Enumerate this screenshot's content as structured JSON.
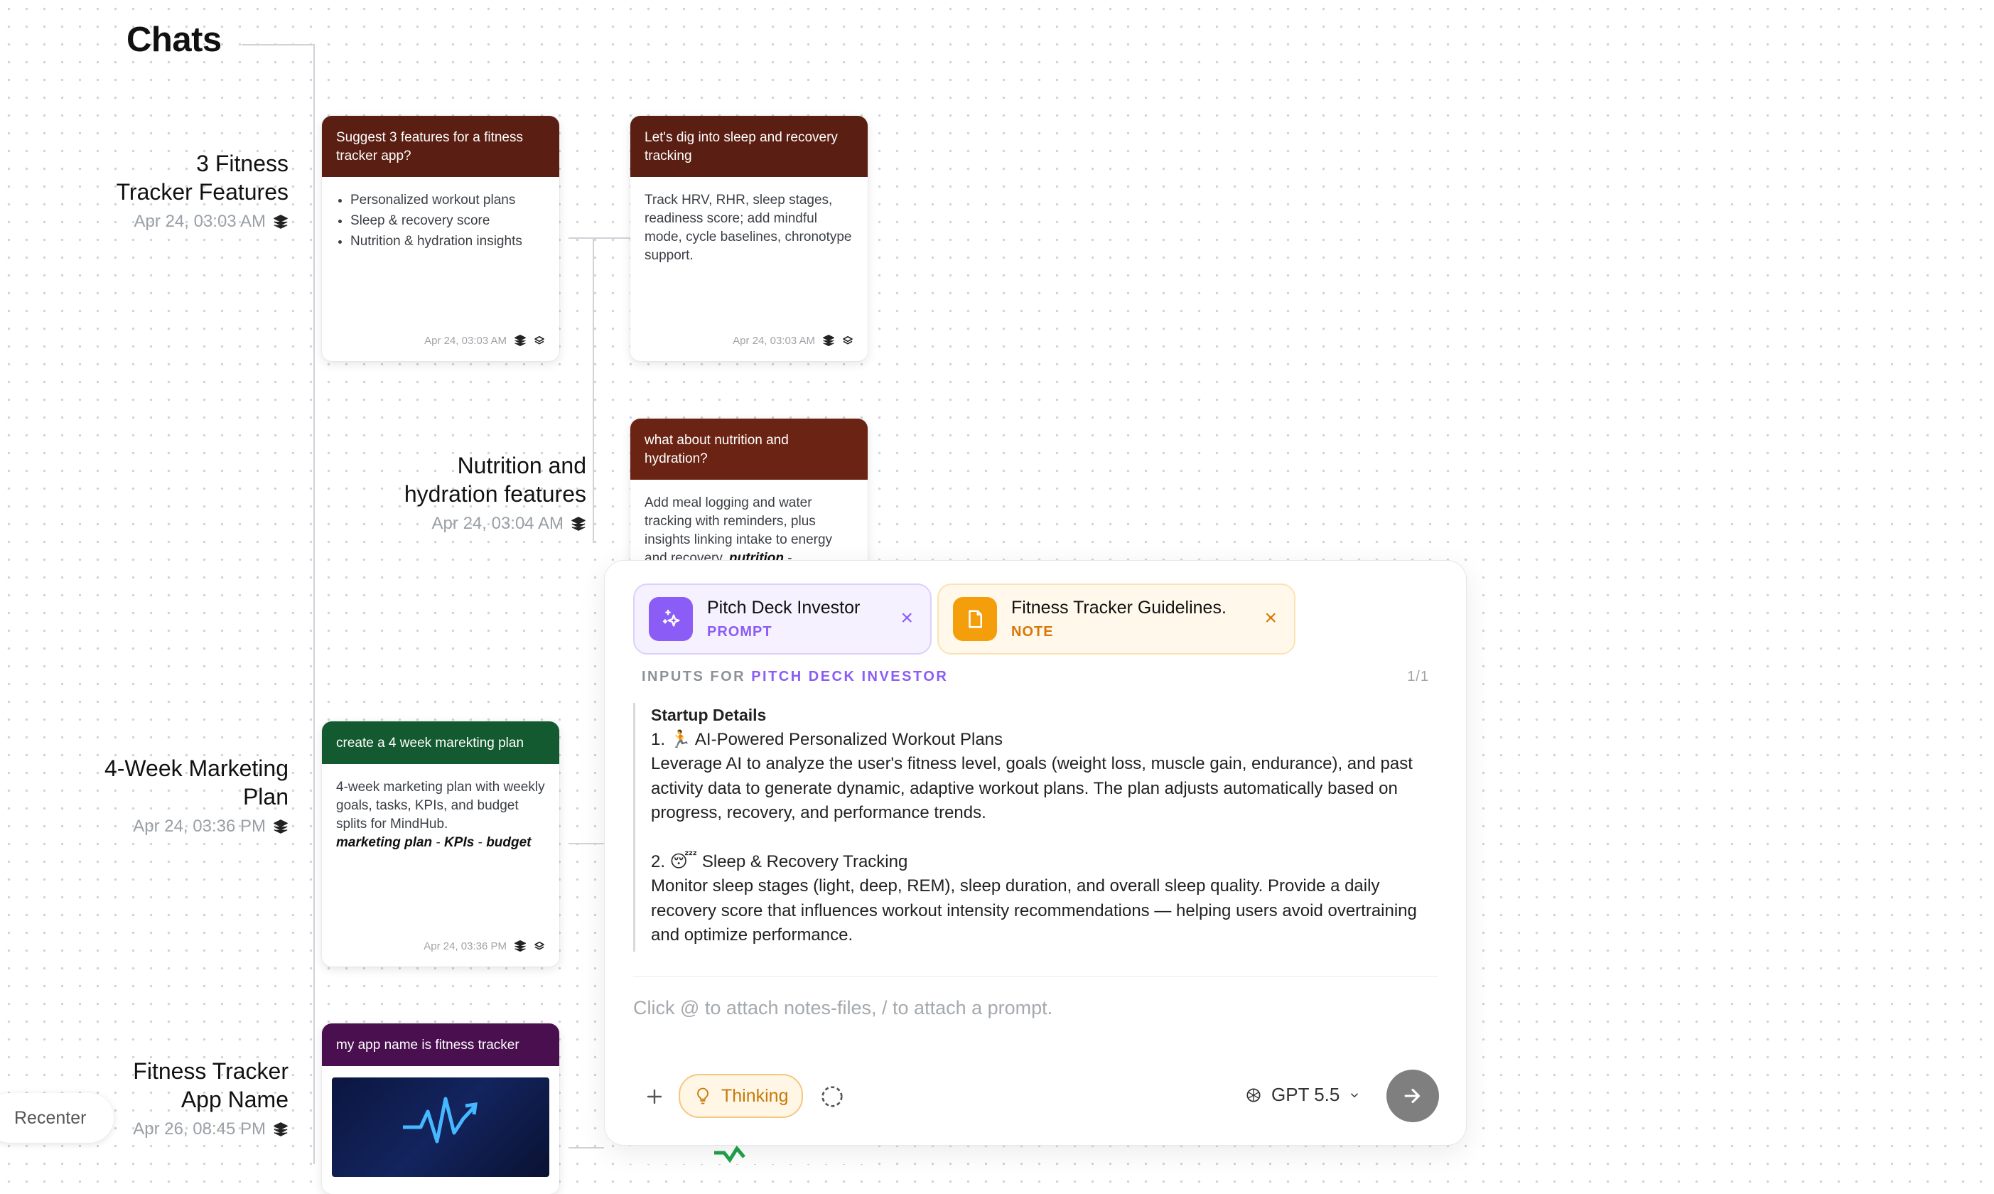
{
  "page": {
    "title": "Chats"
  },
  "chats": [
    {
      "title_line1": "3 Fitness",
      "title_line2": "Tracker Features",
      "date": "Apr 24, 03:03 AM"
    },
    {
      "title_line1": "Nutrition and",
      "title_line2": "hydration features",
      "date": "Apr 24, 03:04 AM"
    },
    {
      "title_line1": "4-Week Marketing",
      "title_line2": "Plan",
      "date": "Apr 24, 03:36 PM"
    },
    {
      "title_line1": "Fitness Tracker",
      "title_line2": "App Name",
      "date": "Apr 26, 08:45 PM"
    }
  ],
  "cards": {
    "features": {
      "prompt": "Suggest 3 features for a fitness tracker app?",
      "bullets": [
        "Personalized workout plans",
        "Sleep & recovery score",
        "Nutrition & hydration insights"
      ],
      "date": "Apr 24, 03:03 AM",
      "head_color": "#5a1e12"
    },
    "sleep": {
      "prompt": "Let's dig into sleep and recovery tracking",
      "body": "Track HRV, RHR, sleep stages, readiness score; add mindful mode, cycle baselines, chronotype support.",
      "date": "Apr 24, 03:03 AM",
      "head_color": "#5a1e12"
    },
    "nutrition": {
      "prompt": "what about nutrition and hydration?",
      "body": "Add meal logging and water tracking with reminders, plus insights linking intake to energy and recovery.",
      "tag1": "nutrition",
      "sep": "-",
      "head_color": "#6b2413"
    },
    "marketing": {
      "prompt": "create a 4 week marekting plan",
      "body": "4-week marketing plan with weekly goals, tasks, KPIs, and budget splits for MindHub.",
      "tags": [
        "marketing plan",
        "KPIs",
        "budget"
      ],
      "sep": "-",
      "date": "Apr 24, 03:36 PM",
      "head_color": "#145a30"
    },
    "appname": {
      "prompt": "my app name is fitness tracker",
      "head_color": "#4a0f4f"
    }
  },
  "composer": {
    "chips": [
      {
        "name": "Pitch Deck Investor",
        "kind": "PROMPT",
        "icon": "sparkle-icon",
        "accent": "#8b5cf6"
      },
      {
        "name": "Fitness Tracker Guidelines.",
        "kind": "NOTE",
        "icon": "file-icon",
        "accent": "#f59e0b"
      }
    ],
    "inputs_label_prefix": "INPUTS FOR",
    "inputs_label_target": "PITCH DECK INVESTOR",
    "pager": "1/1",
    "section_title": "Startup Details",
    "item1_title": "1. 🏃 AI-Powered Personalized Workout Plans",
    "item1_body": "Leverage AI to analyze the user's fitness level, goals (weight loss, muscle gain, endurance), and past activity data to generate dynamic, adaptive workout plans. The plan adjusts automatically based on progress, recovery, and performance trends.",
    "item2_title": "2. 😴 Sleep & Recovery Tracking",
    "item2_body": "Monitor sleep stages (light, deep, REM), sleep duration, and overall sleep quality. Provide a daily recovery score that influences workout intensity recommendations — helping users avoid overtraining and optimize performance.",
    "placeholder": "Click @ to attach notes-files, / to attach a prompt.",
    "thinking_label": "Thinking",
    "model_label": "GPT 5.5"
  },
  "recenter_label": "Recenter"
}
